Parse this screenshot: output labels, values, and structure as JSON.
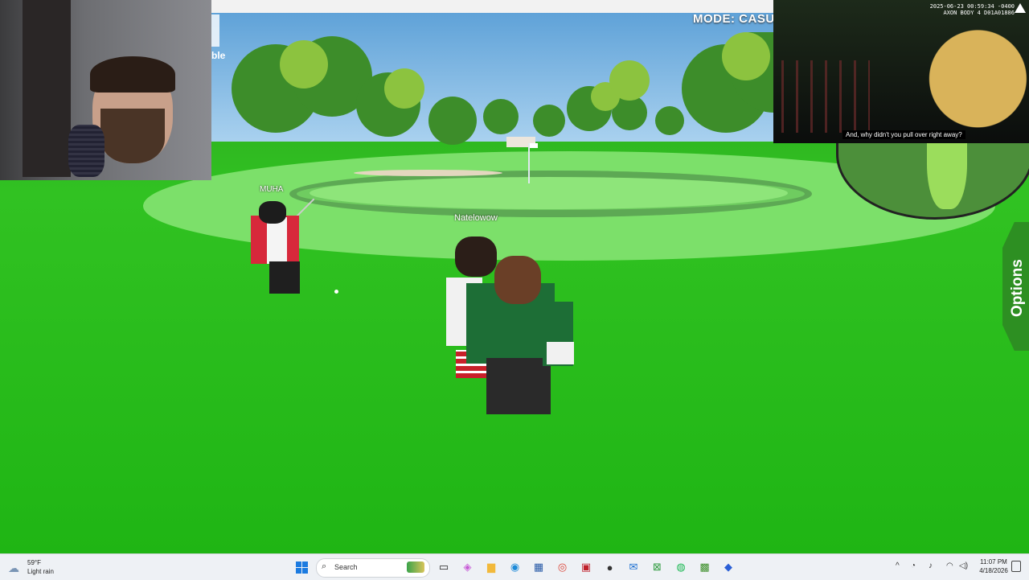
{
  "game": {
    "mode_label": "MODE: CASUA",
    "partial_label": "ble",
    "player_names": {
      "left_player": "MUHA",
      "center_player": "Natelowow"
    },
    "options_label": "Options"
  },
  "bodycam": {
    "timestamp": "2025-06-23 00:59:34 -0400",
    "device": "AXON BODY 4 D01A01886",
    "subtitle": "And, why didn't you pull over right away?"
  },
  "taskbar": {
    "weather": {
      "temp": "59°F",
      "desc": "Light rain",
      "icon": "rain-cloud-icon"
    },
    "search_placeholder": "Search",
    "apps": [
      {
        "name": "task-view-icon",
        "glyph": "▭",
        "color": "#222222"
      },
      {
        "name": "copilot-icon",
        "glyph": "◈",
        "color": "#c75bd6"
      },
      {
        "name": "file-explorer-icon",
        "glyph": "▆",
        "color": "#f2b93b"
      },
      {
        "name": "edge-icon",
        "glyph": "◉",
        "color": "#1c8ad8"
      },
      {
        "name": "calculator-icon",
        "glyph": "▦",
        "color": "#2a5ca8"
      },
      {
        "name": "chrome-icon",
        "glyph": "◎",
        "color": "#db4437"
      },
      {
        "name": "streamer-app-icon",
        "glyph": "▣",
        "color": "#c0202a"
      },
      {
        "name": "obs-icon",
        "glyph": "●",
        "color": "#333333"
      },
      {
        "name": "outlook-icon",
        "glyph": "✉",
        "color": "#1c6fd1"
      },
      {
        "name": "xbox-icon",
        "glyph": "⊠",
        "color": "#2f9b3f"
      },
      {
        "name": "spotify-icon",
        "glyph": "◍",
        "color": "#1db954"
      },
      {
        "name": "minecraft-icon",
        "glyph": "▩",
        "color": "#3c8f2a"
      },
      {
        "name": "roblox-icon",
        "glyph": "◆",
        "color": "#2a5fd6"
      }
    ],
    "tray": {
      "chevron": "^",
      "clock_time": "11:07 PM",
      "clock_date": "4/18/2026"
    }
  },
  "colors": {
    "accent": "#1c7be0",
    "grass": "#2fc21e",
    "options_tab": "#2d8f22"
  }
}
